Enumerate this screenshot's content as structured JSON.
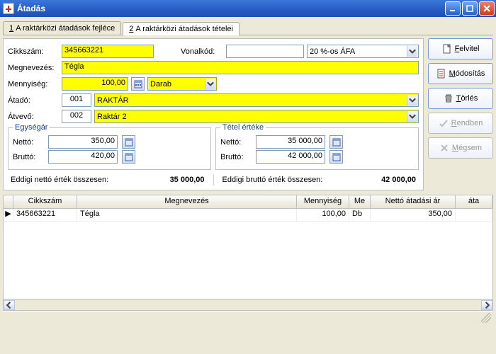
{
  "window": {
    "title": "Átadás"
  },
  "tabs": [
    {
      "num": "1",
      "label": "A raktárközi átadások fejléce"
    },
    {
      "num": "2",
      "label": "A raktárközi átadások tételei"
    }
  ],
  "form": {
    "cikkszam_label": "Cikkszám:",
    "cikkszam": "345663221",
    "vonalkod_label": "Vonalkód:",
    "vonalkod": "",
    "afa": "20 %-os ÁFA",
    "megnevezes_label": "Megnevezés:",
    "megnevezes": "Tégla",
    "mennyiseg_label": "Mennyiség:",
    "mennyiseg": "100,00",
    "egyseg": "Darab",
    "atado_label": "Átadó:",
    "atado_code": "001",
    "atado_name": "RAKTÁR",
    "atvevo_label": "Átvevő:",
    "atvevo_code": "002",
    "atvevo_name": "Raktár 2",
    "egysegar": {
      "legend": "Egységár",
      "netto_label": "Nettó:",
      "netto": "350,00",
      "brutto_label": "Bruttó:",
      "brutto": "420,00"
    },
    "tetel": {
      "legend": "Tétel értéke",
      "netto_label": "Nettó:",
      "netto": "35 000,00",
      "brutto_label": "Bruttó:",
      "brutto": "42 000,00"
    },
    "sum_netto_label": "Eddigi nettó érték összesen:",
    "sum_netto": "35 000,00",
    "sum_brutto_label": "Eddigi bruttó érték összesen:",
    "sum_brutto": "42 000,00"
  },
  "buttons": {
    "felvitel": "Felvitel",
    "modositas": "Módosítás",
    "torles": "Törlés",
    "rendben": "Rendben",
    "megsem": "Mégsem"
  },
  "grid": {
    "cols": {
      "cikkszam": "Cikkszám",
      "megnevezes": "Megnevezés",
      "mennyiseg": "Mennyiség",
      "me": "Me",
      "netto_ar": "Nettó átadási ár",
      "ata": "áta"
    },
    "rows": [
      {
        "cikkszam": "345663221",
        "megnevezes": "Tégla",
        "mennyiseg": "100,00",
        "me": "Db",
        "netto_ar": "350,00"
      }
    ]
  }
}
